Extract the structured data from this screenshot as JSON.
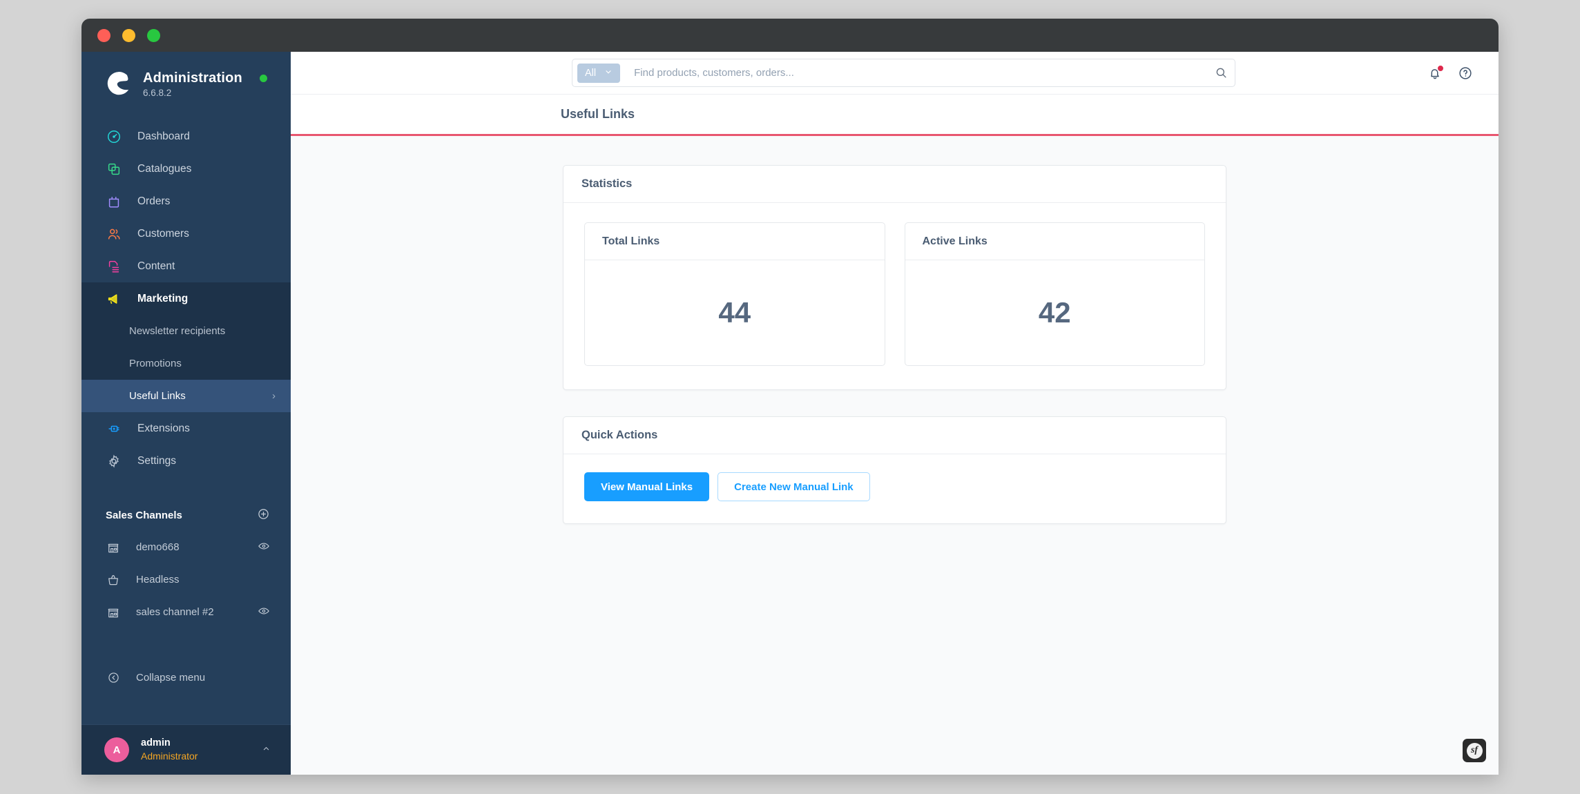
{
  "window": {
    "traffic_lights": [
      "close",
      "minimize",
      "maximize"
    ]
  },
  "sidebar": {
    "brand": {
      "title": "Administration",
      "version": "6.6.8.2",
      "status_color": "#28c840"
    },
    "nav_items": [
      {
        "label": "Dashboard",
        "icon": "dashboard-icon",
        "color": "#23d7d7"
      },
      {
        "label": "Catalogues",
        "icon": "catalogues-icon",
        "color": "#37d98a"
      },
      {
        "label": "Orders",
        "icon": "orders-icon",
        "color": "#a18cff"
      },
      {
        "label": "Customers",
        "icon": "customers-icon",
        "color": "#ff7a45"
      },
      {
        "label": "Content",
        "icon": "content-icon",
        "color": "#f53fa0"
      },
      {
        "label": "Marketing",
        "icon": "marketing-icon",
        "color": "#f5e51a"
      }
    ],
    "marketing_submenu": [
      {
        "label": "Newsletter recipients",
        "selected": false
      },
      {
        "label": "Promotions",
        "selected": false
      },
      {
        "label": "Useful Links",
        "selected": true,
        "chevron": "›"
      }
    ],
    "nav_items_bottom": [
      {
        "label": "Extensions",
        "icon": "extensions-icon",
        "color": "#189eff"
      },
      {
        "label": "Settings",
        "icon": "gear-icon",
        "color": "#b5c0ce"
      }
    ],
    "sales_channels": {
      "heading": "Sales Channels",
      "add_icon": "plus-circle-icon",
      "items": [
        {
          "label": "demo668",
          "icon": "storefront-icon",
          "action_icon": "eye-icon"
        },
        {
          "label": "Headless",
          "icon": "basket-icon",
          "action_icon": ""
        },
        {
          "label": "sales channel #2",
          "icon": "storefront-icon",
          "action_icon": "eye-icon"
        }
      ]
    },
    "collapse": {
      "label": "Collapse menu",
      "icon": "collapse-left-icon"
    },
    "user": {
      "initial": "A",
      "name": "admin",
      "role": "Administrator",
      "avatar_color": "#ec5e9c",
      "caret": "⌃"
    }
  },
  "topbar": {
    "search": {
      "scope_label": "All",
      "scope_caret": "▾",
      "value": "",
      "placeholder": "Find products, customers, orders...",
      "search_icon": "search-icon"
    },
    "notifications_icon": "bell-icon",
    "has_notification": true,
    "help_icon": "help-circle-icon"
  },
  "page": {
    "title": "Useful Links",
    "accent_color": "#e8566f"
  },
  "statistics": {
    "card_title": "Statistics",
    "cards": [
      {
        "label": "Total Links",
        "value": "44"
      },
      {
        "label": "Active Links",
        "value": "42"
      }
    ]
  },
  "quick_actions": {
    "card_title": "Quick Actions",
    "buttons": [
      {
        "label": "View Manual Links",
        "style": "primary"
      },
      {
        "label": "Create New Manual Link",
        "style": "ghost"
      }
    ]
  },
  "profiler": {
    "badge": "sf"
  }
}
